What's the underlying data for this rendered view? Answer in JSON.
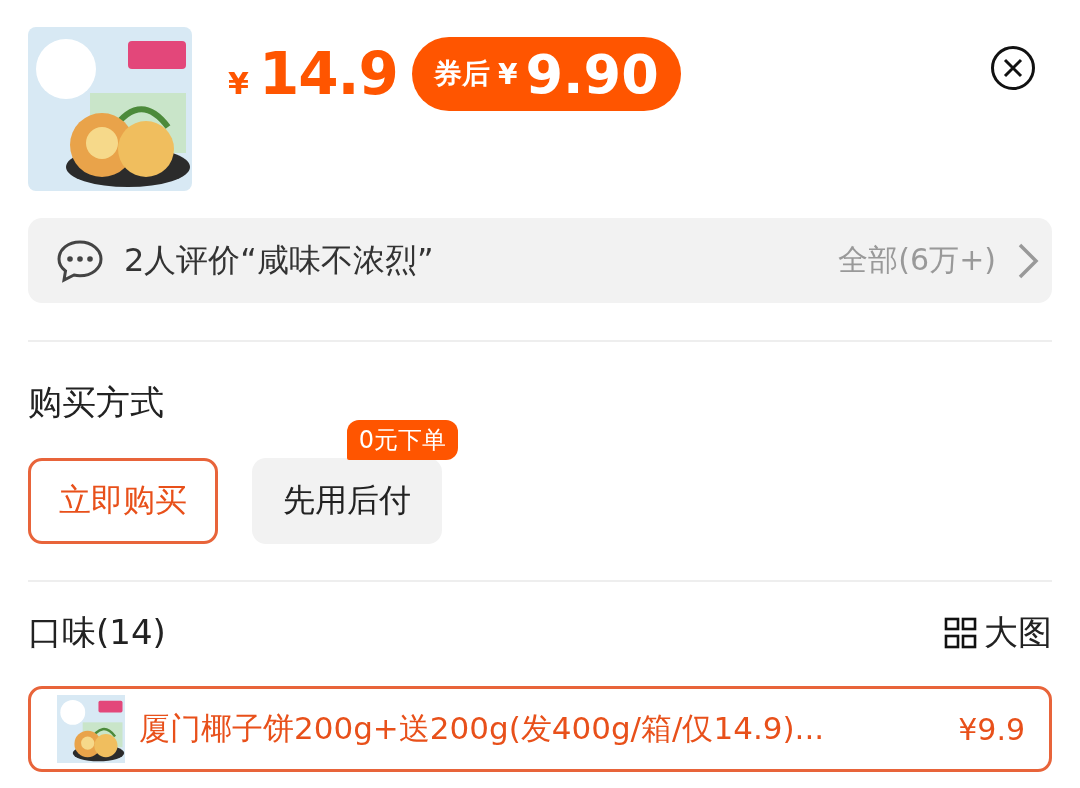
{
  "product": {
    "price_symbol": "¥",
    "price": "14.9",
    "coupon": {
      "label": "券后",
      "symbol": "¥",
      "price": "9.90"
    }
  },
  "review_bar": {
    "text": "2人评价“咸味不浓烈”",
    "all_label": "全部(6万+)"
  },
  "purchase": {
    "title": "购买方式",
    "options": [
      {
        "label": "立即购买",
        "selected": true
      },
      {
        "label": "先用后付",
        "selected": false,
        "badge": "0元下单"
      }
    ]
  },
  "flavor": {
    "title": "口味(14)",
    "view_label": "大图",
    "options": [
      {
        "label": "厦门椰子饼200g+送200g(发400g/箱/仅14.9)...",
        "price": "¥9.9",
        "selected": true
      }
    ]
  }
}
